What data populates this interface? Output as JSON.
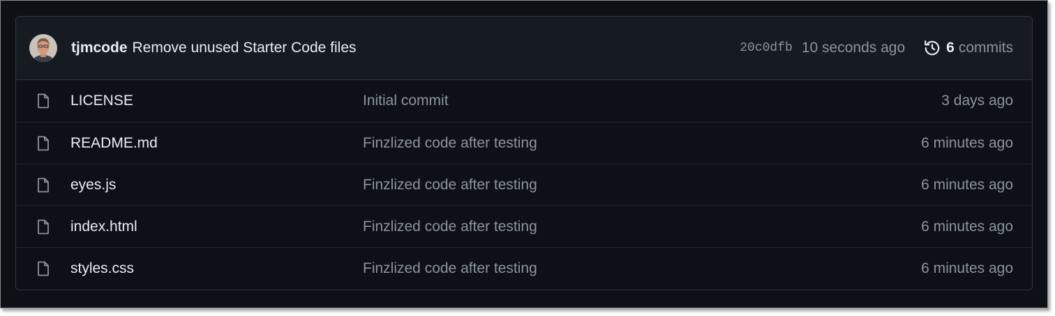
{
  "latest_commit": {
    "author": "tjmcode",
    "message": "Remove unused Starter Code files",
    "sha": "20c0dfb",
    "time": "10 seconds ago",
    "commits_count": "6",
    "commits_label": "commits",
    "history_icon": "history-icon"
  },
  "files": [
    {
      "name": "LICENSE",
      "message": "Initial commit",
      "time": "3 days ago",
      "icon": "file-icon"
    },
    {
      "name": "README.md",
      "message": "Finzlized code after testing",
      "time": "6 minutes ago",
      "icon": "file-icon"
    },
    {
      "name": "eyes.js",
      "message": "Finzlized code after testing",
      "time": "6 minutes ago",
      "icon": "file-icon"
    },
    {
      "name": "index.html",
      "message": "Finzlized code after testing",
      "time": "6 minutes ago",
      "icon": "file-icon"
    },
    {
      "name": "styles.css",
      "message": "Finzlized code after testing",
      "time": "6 minutes ago",
      "icon": "file-icon"
    }
  ],
  "colors": {
    "background": "#0d1117",
    "header_background": "#161b22",
    "border": "#30363d",
    "text_primary": "#e6edf3",
    "text_muted": "#8b949e"
  }
}
